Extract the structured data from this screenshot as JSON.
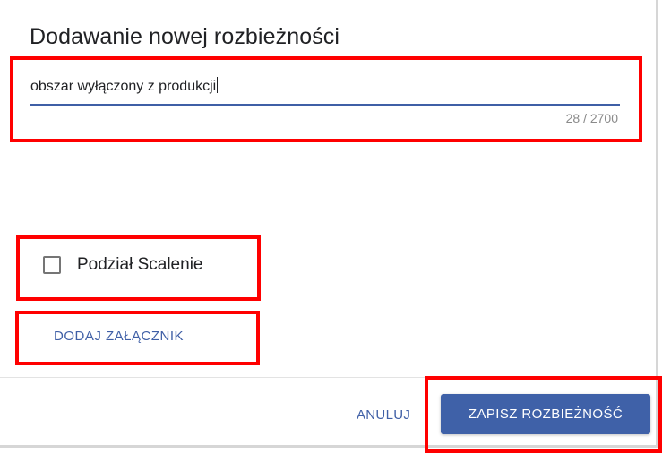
{
  "dialog": {
    "title": "Dodawanie nowej rozbieżności",
    "textfield": {
      "value": "obszar wyłączony z produkcji",
      "counter": "28 / 2700"
    },
    "checkbox": {
      "label": "Podział Scalenie",
      "checked": false
    },
    "attach_label": "DODAJ ZAŁĄCZNIK",
    "cancel_label": "ANULUJ",
    "save_label": "ZAPISZ ROZBIEŻNOŚĆ"
  },
  "colors": {
    "accent": "#3f61a8",
    "highlight": "#ff0000",
    "text": "#202124",
    "muted": "#8a8a8a"
  }
}
